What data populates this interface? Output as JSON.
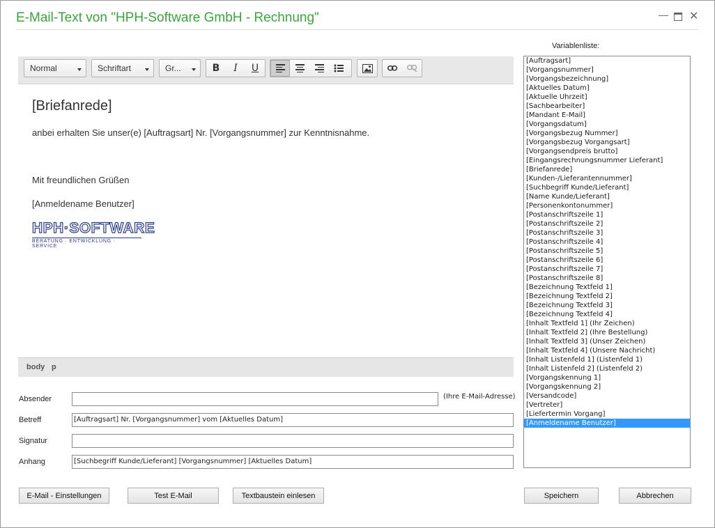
{
  "window": {
    "title": "E-Mail-Text von \"HPH-Software GmbH - Rechnung\"",
    "controls": {
      "minimize": "—",
      "close": "✕"
    }
  },
  "toolbar": {
    "format": "Normal",
    "font": "Schriftart",
    "size": "Gr...",
    "bold": "B",
    "italic": "I",
    "underline": "U"
  },
  "editor": {
    "salutation": "[Briefanrede]",
    "line1": "anbei erhalten Sie unser(e) [Auftragsart] Nr. [Vorgangsnummer] zur Kenntnisnahme.",
    "line2": "Mit freundlichen Grüßen",
    "line3": "[Anmeldename Benutzer]",
    "logo_main": "HPH·SOFTWARE",
    "logo_sub": "BERATUNG · ENTWICKLUNG · SERVICE"
  },
  "pathbar": {
    "body": "body",
    "p": "p"
  },
  "variables": {
    "label": "Variablenliste:",
    "items": [
      "[Auftragsart]",
      "[Vorgangsnummer]",
      "[Vorgangsbezeichnung]",
      "[Aktuelles Datum]",
      "[Aktuelle Uhrzeit]",
      "[Sachbearbeiter]",
      "[Mandant E-Mail]",
      "[Vorgangsdatum]",
      "[Vorgangsbezug Nummer]",
      "[Vorgangsbezug Vorgangsart]",
      "[Vorgangsendpreis brutto]",
      "[Eingangsrechnungsnummer Lieferant]",
      "[Briefanrede]",
      "[Kunden-/Lieferantennummer]",
      "[Suchbegriff Kunde/Lieferant]",
      "[Name Kunde/Lieferant]",
      "[Personenkontonummer]",
      "[Postanschriftszeile 1]",
      "[Postanschriftszeile 2]",
      "[Postanschriftszeile 3]",
      "[Postanschriftszeile 4]",
      "[Postanschriftszeile 5]",
      "[Postanschriftszeile 6]",
      "[Postanschriftszeile 7]",
      "[Postanschriftszeile 8]",
      "[Bezeichnung Textfeld 1]",
      "[Bezeichnung Textfeld 2]",
      "[Bezeichnung Textfeld 3]",
      "[Bezeichnung Textfeld 4]",
      "[Inhalt Textfeld 1] (Ihr Zeichen)",
      "[Inhalt Textfeld 2] (Ihre Bestellung)",
      "[Inhalt Textfeld 3] (Unser Zeichen)",
      "[Inhalt Textfeld 4] (Unsere Nachricht)",
      "[Inhalt Listenfeld 1] (Listenfeld 1)",
      "[Inhalt Listenfeld 2] (Listenfeld 2)",
      "[Vorgangskennung 1]",
      "[Vorgangskennung 2]",
      "[Versandcode]",
      "[Vertreter]",
      "[Liefertermin Vorgang]",
      "[Anmeldename Benutzer]"
    ],
    "selected_index": 40
  },
  "fields": {
    "absender": {
      "label": "Absender",
      "value": "",
      "hint": "(Ihre E-Mail-Adresse)"
    },
    "betreff": {
      "label": "Betreff",
      "value": "[Auftragsart] Nr. [Vorgangsnummer] vom [Aktuelles Datum]"
    },
    "signatur": {
      "label": "Signatur",
      "value": ""
    },
    "anhang": {
      "label": "Anhang",
      "value": "[Suchbegriff Kunde/Lieferant] [Vorgangsnummer] [Aktuelles Datum]"
    }
  },
  "buttons": {
    "email_settings": "E-Mail - Einstellungen",
    "test_email": "Test E-Mail",
    "textbaustein": "Textbaustein einlesen",
    "save": "Speichern",
    "cancel": "Abbrechen"
  },
  "colors": {
    "title": "#3aa63a",
    "selection": "#3399ff",
    "logo": "#2a3b8f"
  }
}
